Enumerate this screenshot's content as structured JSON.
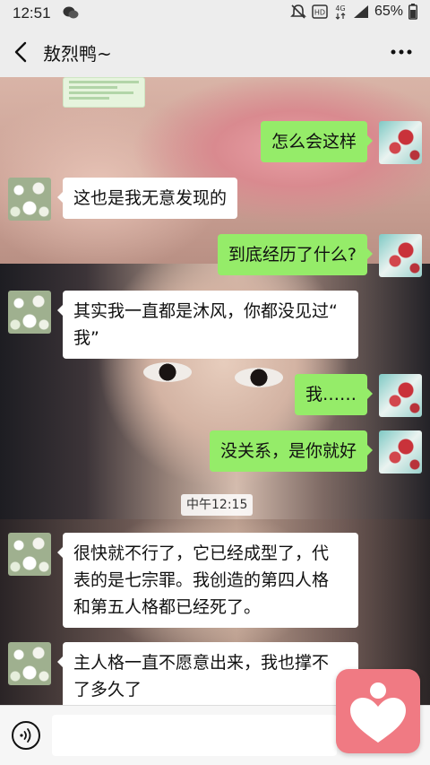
{
  "status_bar": {
    "time": "12:51",
    "battery": "65%",
    "icons": [
      "wechat-icon",
      "mute-icon",
      "hd-icon",
      "4g-icon",
      "signal-icon",
      "battery-icon"
    ]
  },
  "header": {
    "title": "敖烈鸭~",
    "back_icon": "back-arrow-icon",
    "more_icon": "more-icon"
  },
  "messages": [
    {
      "side": "right",
      "text": "怎么会这样"
    },
    {
      "side": "left",
      "text": "这也是我无意发现的"
    },
    {
      "side": "right",
      "text": "到底经历了什么?"
    },
    {
      "side": "left",
      "text_line1": "其实我一直都是沐风，你都没见过“",
      "text_line2": "我”"
    },
    {
      "side": "right",
      "text": "我……"
    },
    {
      "side": "right",
      "text": "没关系，是你就好"
    },
    {
      "side": "left",
      "text_line1": "很快就不行了，它已经成型了，代",
      "text_line2": "表的是七宗罪。我创造的第四人格",
      "text_line3": "和第五人格都已经死了。"
    },
    {
      "side": "left",
      "text_line1": "主人格一直不愿意出来，我也撑不",
      "text_line2": "了多久了"
    }
  ],
  "timestamp": "中午12:15",
  "input_bar": {
    "voice_icon": "voice-icon",
    "placeholder": ""
  },
  "floating_button": {
    "icon": "heart-figure-icon"
  },
  "colors": {
    "right_bubble": "#95ec69",
    "left_bubble": "#ffffff",
    "floating_button": "#f07a83",
    "bar_background": "#ededed"
  }
}
